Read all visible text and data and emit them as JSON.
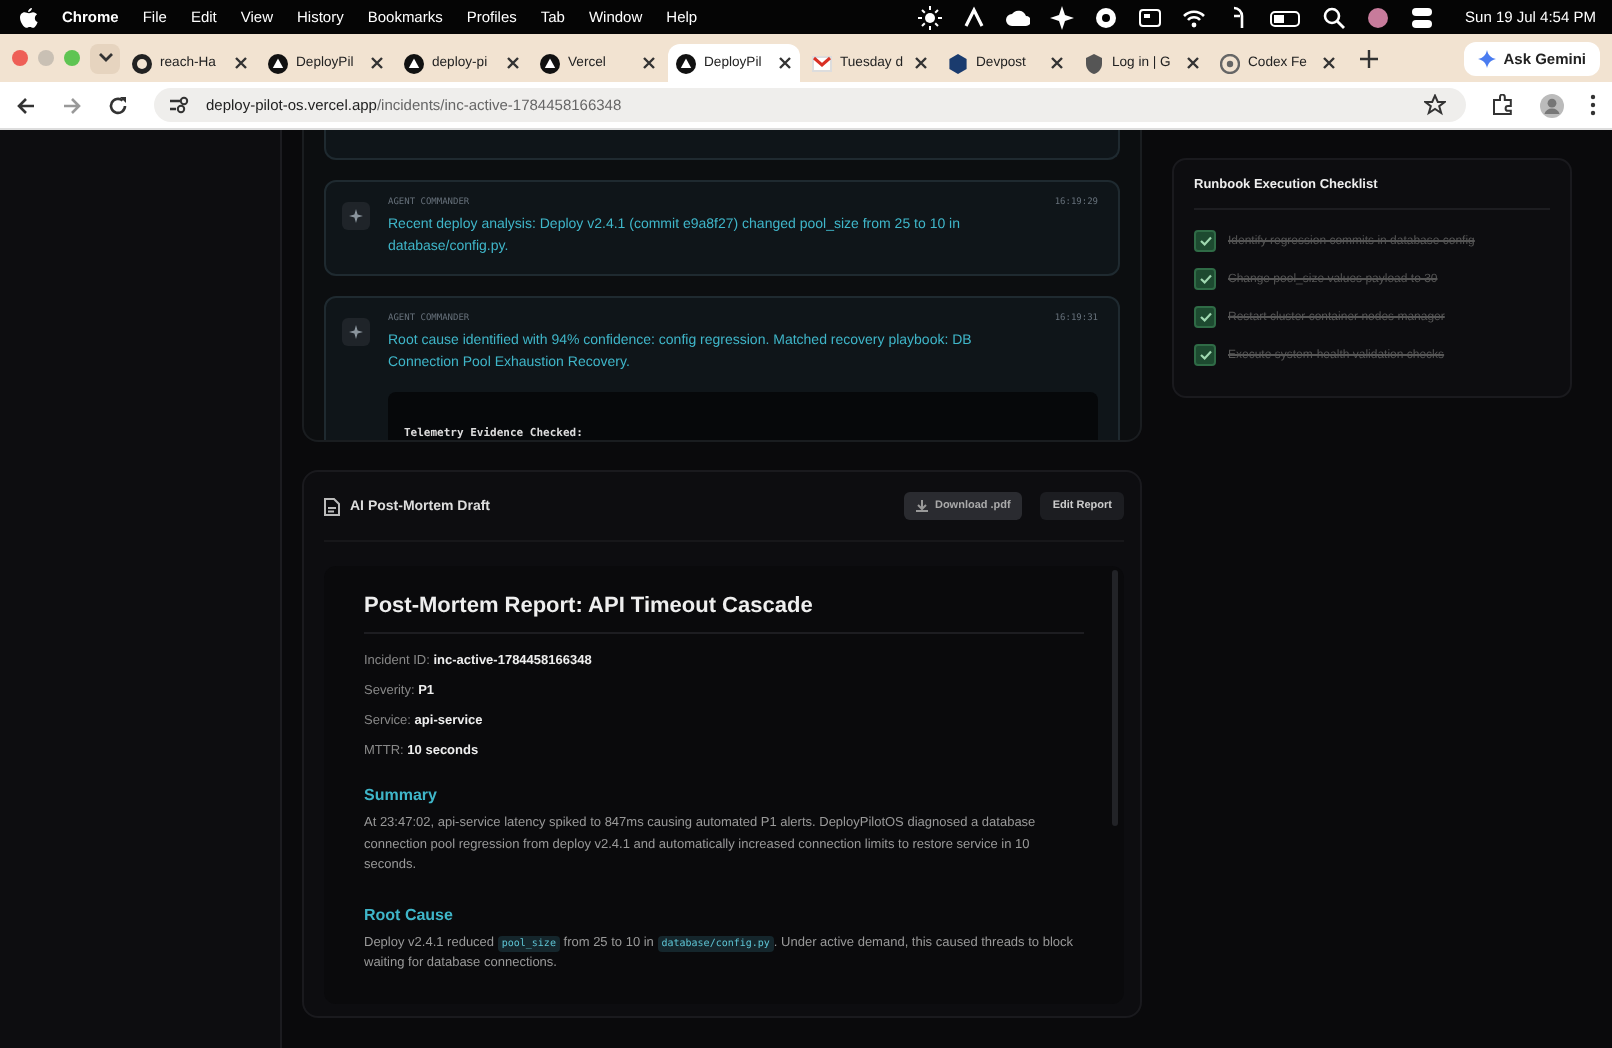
{
  "menu_bar": {
    "app": "Chrome",
    "items": [
      "File",
      "Edit",
      "View",
      "History",
      "Bookmarks",
      "Profiles",
      "Tab",
      "Window",
      "Help"
    ],
    "clock": "Sun 19 Jul  4:54 PM"
  },
  "tabs": [
    {
      "label": "reach-Ha",
      "kind": "cat",
      "selected": false
    },
    {
      "label": "DeployPil",
      "kind": "triangle",
      "selected": false
    },
    {
      "label": "deploy-pi",
      "kind": "triangle",
      "selected": false
    },
    {
      "label": "Vercel",
      "kind": "triangle",
      "selected": false
    },
    {
      "label": "DeployPil",
      "kind": "triangle",
      "selected": true
    },
    {
      "label": "Tuesday d",
      "kind": "envelope",
      "selected": false
    },
    {
      "label": "Devpost",
      "kind": "hexagon",
      "selected": false
    },
    {
      "label": "Log in | G",
      "kind": "shield",
      "selected": false
    },
    {
      "label": "Codex Fe",
      "kind": "ring",
      "selected": false
    }
  ],
  "ask_gemini": "Ask Gemini",
  "address": {
    "host": "deploy-pilot-os.vercel.app",
    "path": "/incidents/inc-active-1784458166348"
  },
  "agent_log": [
    {
      "author": "AGENT COMMANDER",
      "time": "16:19:29",
      "message": "Recent deploy analysis: Deploy v2.4.1 (commit e9a8f27) changed pool_size from 25 to 10 in database/config.py."
    },
    {
      "author": "AGENT COMMANDER",
      "time": "16:19:31",
      "message": "Root cause identified with 94% confidence: config regression. Matched recovery playbook: DB Connection Pool Exhaustion Recovery.",
      "evidence_title": "Telemetry Evidence Checked:"
    }
  ],
  "postmortem": {
    "heading": "AI Post-Mortem Draft",
    "buttons": [
      {
        "label": "Download .pdf",
        "kind": "download"
      },
      {
        "label": "Edit Report",
        "kind": "plain"
      }
    ],
    "title": "Post-Mortem Report: API Timeout Cascade",
    "fields": [
      {
        "label": "Incident ID:",
        "value": "inc-active-1784458166348"
      },
      {
        "label": "Severity:",
        "value": "P1"
      },
      {
        "label": "Service:",
        "value": "api-service"
      },
      {
        "label": "MTTR:",
        "value": "10 seconds"
      }
    ],
    "sections": [
      {
        "heading": "Summary",
        "parts": [
          {
            "kind": "text",
            "text": "At 23:47:02, api-service latency spiked to 847ms causing automated P1 alerts. DeployPilotOS diagnosed a database connection pool regression from deploy v2.4.1 and automatically increased connection limits to restore service in 10 seconds."
          }
        ]
      },
      {
        "heading": "Root Cause",
        "parts": [
          {
            "kind": "text",
            "text": "Deploy v2.4.1 reduced "
          },
          {
            "kind": "code",
            "text": "pool_size"
          },
          {
            "kind": "text",
            "text": " from 25 to 10 in "
          },
          {
            "kind": "code",
            "text": "database/config.py"
          },
          {
            "kind": "text",
            "text": ". Under active demand, this caused threads to block waiting for database connections."
          }
        ]
      }
    ]
  },
  "checklist": {
    "title": "Runbook Execution Checklist",
    "items": [
      {
        "text": "Identify regression commits in database config",
        "checked": true
      },
      {
        "text": "Change pool_size values payload to 30",
        "checked": true
      },
      {
        "text": "Restart cluster container nodes manager",
        "checked": true
      },
      {
        "text": "Execute system-health validation checks",
        "checked": true
      }
    ]
  }
}
